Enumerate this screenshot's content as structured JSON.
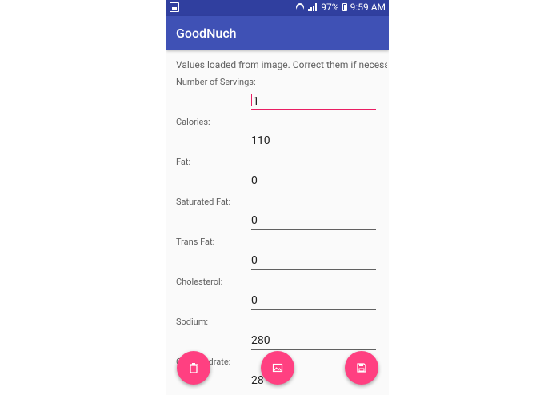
{
  "status_bar": {
    "battery": "97%",
    "time": "9:59 AM"
  },
  "app_bar": {
    "title": "GoodNuch"
  },
  "intro": "Values loaded from image. Correct them if necessary",
  "fields": [
    {
      "label": "Number of Servings:",
      "value": "1"
    },
    {
      "label": "Calories:",
      "value": "110"
    },
    {
      "label": "Fat:",
      "value": "0"
    },
    {
      "label": "Saturated Fat:",
      "value": "0"
    },
    {
      "label": "Trans Fat:",
      "value": "0"
    },
    {
      "label": "Cholesterol:",
      "value": "0"
    },
    {
      "label": "Sodium:",
      "value": "280"
    },
    {
      "label": "Carbohydrate:",
      "value": "28"
    }
  ],
  "fabs": [
    {
      "icon": "trash-icon"
    },
    {
      "icon": "image-icon"
    },
    {
      "icon": "save-icon"
    }
  ],
  "colors": {
    "primary": "#3f51b5",
    "primary_dark": "#303f9f",
    "accent": "#ff4081",
    "active_underline": "#e91e63"
  }
}
